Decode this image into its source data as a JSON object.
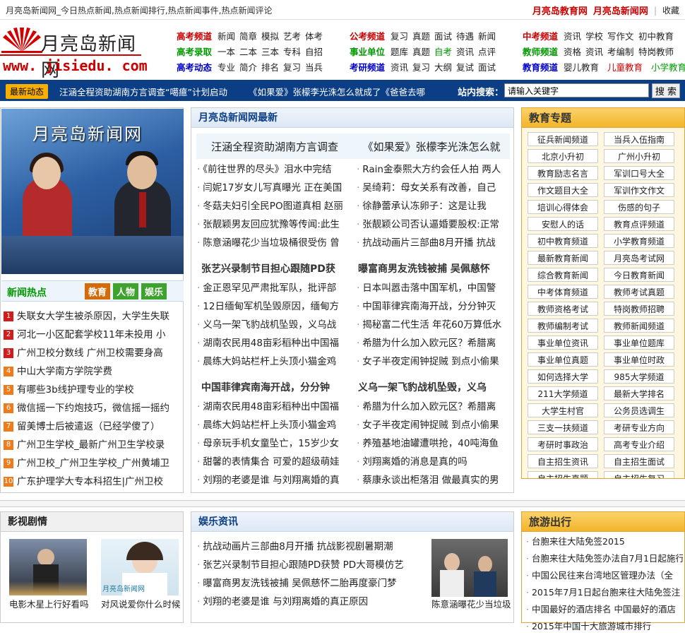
{
  "topbar": {
    "title": "月亮岛新闻网_今日热点新闻,热点新闻排行,热点新闻事件,热点新闻评论",
    "link1": "月亮岛教育网",
    "link2": "月亮岛新闻网",
    "sep": "|",
    "fav": "收藏"
  },
  "logo": {
    "cn": "月亮岛新闻网",
    "en": "www. jisiedu. com"
  },
  "nav": {
    "g1": [
      {
        "head": "高考频道",
        "color": "red",
        "items": [
          "新闻",
          "简章",
          "模拟",
          "艺考",
          "体考"
        ]
      },
      {
        "head": "高考录取",
        "color": "green",
        "items": [
          "一本",
          "二本",
          "三本",
          "专科",
          "自招"
        ]
      },
      {
        "head": "高考动态",
        "color": "blue",
        "items": [
          "专业",
          "简介",
          "排名",
          "复习",
          "当兵"
        ]
      }
    ],
    "g2": [
      {
        "head": "公考频道",
        "color": "red",
        "items": [
          "复习",
          "真题",
          "面试",
          "待遇",
          "新闻"
        ]
      },
      {
        "head": "事业单位",
        "color": "green",
        "items": [
          "题库",
          "真题",
          "自考",
          "资讯",
          "点评"
        ]
      },
      {
        "head": "考研频道",
        "color": "blue",
        "items": [
          "资讯",
          "复习",
          "大纲",
          "复试",
          "面试"
        ]
      }
    ],
    "g3": [
      {
        "head": "中考频道",
        "color": "red",
        "items": [
          "资讯",
          "学校",
          "写作文",
          "初中教育"
        ]
      },
      {
        "head": "教师频道",
        "color": "green",
        "items": [
          "资格",
          "资讯",
          "考编制",
          "特岗教师"
        ]
      },
      {
        "head": "教育频道",
        "color": "blue",
        "items": [
          "婴儿教育",
          "儿童教育",
          "小学教育"
        ]
      }
    ]
  },
  "newsbar": {
    "tag": "最新动态",
    "items": [
      "汪涵全程资助湖南方言调查“噶癔”计划启动",
      "《如果爱》张檬李光洙怎么就成了《爸爸去哪"
    ],
    "search_label": "站内搜索：",
    "search_value": "请输入关键字",
    "search_button": "搜 索"
  },
  "left": {
    "tv_title": "月亮岛新闻网",
    "hot_title": "新闻热点",
    "tabs": [
      "教育",
      "人物",
      "娱乐"
    ],
    "hot": [
      "失联女大学生被杀原因，大学生失联",
      "河北一小区配套学校11年未投用 小",
      "广州卫校分数线 广州卫校需要身高",
      "中山大学南方学院学费",
      "有哪些3b线护理专业的学校",
      "微信摇一下约炮技巧，微信摇一摇约",
      "留美博士后被遣返（已经学傻了）",
      "广州卫生学校_最新广州卫生学校录",
      "广州卫校_广州卫生学校_广州黄埔卫",
      "广东护理学大专本科招生|广州卫校"
    ]
  },
  "mid": {
    "title": "月亮岛新闻网最新",
    "h1": [
      "汪涵全程资助湖南方言调查",
      "《如果爱》张檬李光洙怎么就"
    ],
    "c1a": [
      "《前往世界的尽头》泪水中完结",
      "闫妮17岁女儿写真曝光 正在美国",
      "冬菇夫妇引全民PO图道真相 赵丽",
      "张靓颖男友回应犹豫等传闻:此生",
      "陈意涵曝花少当垃圾桶很受伤 曾"
    ],
    "c1b": [
      "Rain金泰熙大方约会任人拍 两人",
      "吴绮莉：母女关系有改善，自己",
      "徐静蕾承认冻卵子：这是让我",
      "张靓颖公司否认逼婚要股权:正常",
      "抗战动画片三部曲8月开播 抗战"
    ],
    "h2": [
      "张艺兴录制节目担心跟随PD获",
      "曝富商男友洗钱被捕 吴佩慈怀"
    ],
    "c2a": [
      "金正恩罕见严肃批军队，批评部",
      "12日缅甸军机坠毁原因，缅甸方",
      "义乌一架飞豹战机坠毁，义乌战",
      "湖南农民用48亩彩稻种出中国福",
      "晨练大妈站栏杆上头顶小猫金鸡"
    ],
    "c2b": [
      "日本叫嚣击落中国军机，中国警",
      "中国菲律宾南海开战，分分钟灭",
      "揭秘富二代生活 年花60万算低水",
      "希腊为什么加入欧元区？希腊离",
      "女子半夜定闹钟捉贼 到点小偷果"
    ],
    "h3": [
      "中国菲律宾南海开战，分分钟",
      "义乌一架飞豹战机坠毁，义乌"
    ],
    "c3a": [
      "湖南农民用48亩彩稻种出中国福",
      "晨练大妈站栏杆上头顶小猫金鸡",
      "母亲玩手机女童坠亡，15岁少女",
      "甜馨的表情集合 可爱的超级萌娃",
      "刘翔的老婆是谁 与刘翔离婚的真"
    ],
    "c3b": [
      "希腊为什么加入欧元区？希腊离",
      "女子半夜定闹钟捉贼 到点小偷果",
      "养殖基地油罐遭哄抢，40吨海鱼",
      "刘翔离婚的消息是真的吗",
      "蔡康永谈出柜落泪 做最真实的男"
    ]
  },
  "right": {
    "title": "教育专题",
    "tags": [
      "征兵新闻频道",
      "当兵入伍指南",
      "北京小升初",
      "广州小升初",
      "教育励志名言",
      "军训口号大全",
      "作文题目大全",
      "军训作文作文",
      "培训心得体会",
      "伤感的句子",
      "安慰人的话",
      "教育点评频道",
      "初中教育频道",
      "小学教育频道",
      "最新教育新闻",
      "月亮岛考试网",
      "综合教育新闻",
      "今日教育新闻",
      "中考体育频道",
      "教师考试真题",
      "教师资格考试",
      "特岗教师招聘",
      "教师编制考试",
      "教师新闻频道",
      "事业单位资讯",
      "事业单位题库",
      "事业单位真题",
      "事业单位时政",
      "如何选择大学",
      "985大学频道",
      "211大学频道",
      "最新大学排名",
      "大学生村官",
      "公务员选调生",
      "三支一扶频道",
      "考研专业方向",
      "考研时事政治",
      "高考专业介绍",
      "自主招生资讯",
      "自主招生面试",
      "自主招生真题",
      "自主招生复习"
    ]
  },
  "film": {
    "title": "影视剧情",
    "cap1": "电影木星上行好看吗",
    "cap2": "对风说爱你什么时候",
    "poster_text": "月亮岛新闻网"
  },
  "ent": {
    "title": "娱乐资讯",
    "items": [
      "抗战动画片三部曲8月开播 抗战影视剧暑期潮",
      "张艺兴录制节目担心跟随PD获赞 PD大哥模仿艺",
      "曝富商男友洗钱被捕 吴佩慈怀二胎再度豪门梦",
      "刘翔的老婆是谁 与刘翔离婚的真正原因"
    ],
    "photo_cap": "陈意涵曝花少当垃圾"
  },
  "travel": {
    "title": "旅游出行",
    "items": [
      "台胞来往大陆免签2015",
      "台胞来往大陆免签办法自7月1日起施行",
      "中国公民往来台湾地区管理办法（全",
      "2015年7月1日起台胞来往大陆免签注",
      "中国最好的酒店排名 中国最好的酒店",
      "2015年中国十大旅游城市排行"
    ]
  }
}
